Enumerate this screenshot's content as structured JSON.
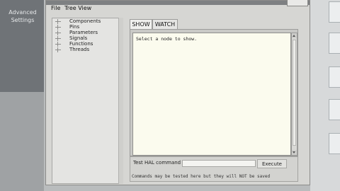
{
  "left_panel": {
    "advanced_settings_label": "Advanced\nSettings"
  },
  "menubar": {
    "items": [
      "File",
      "Tree View"
    ]
  },
  "tree": {
    "items": [
      "Components",
      "Pins",
      "Parameters",
      "Signals",
      "Functions",
      "Threads"
    ]
  },
  "tabs": [
    {
      "label": "SHOW",
      "selected": true
    },
    {
      "label": "WATCH",
      "selected": false
    }
  ],
  "output": {
    "text": "Select a node to show."
  },
  "command": {
    "label": "Test HAL command :",
    "input_value": "",
    "execute_label": "Execute",
    "note": "Commands may be tested here but they will NOT be saved"
  },
  "colors": {
    "window_bg": "#d6d6d3",
    "output_bg": "#fbfbee",
    "left_panel_bg": "#6f7377"
  }
}
